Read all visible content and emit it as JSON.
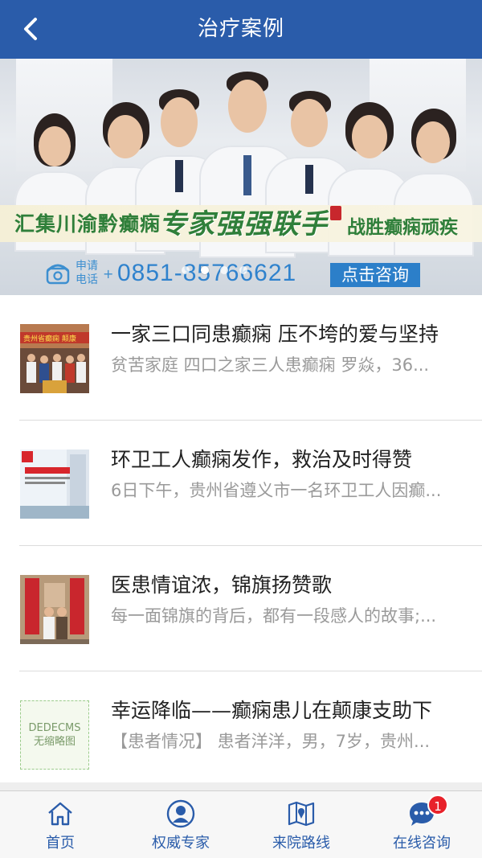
{
  "header": {
    "title": "治疗案例"
  },
  "banner": {
    "slogan_left": "汇集川渝黔癫痫",
    "slogan_mid": "专家强强联手",
    "slogan_right": "战胜癫痫顽疾",
    "phone_apply": "申请",
    "phone_call": "电话",
    "phone_plus": "+",
    "phone_number": "0851-85766621",
    "consult_label": "点击咨询",
    "active_slide": 1,
    "slide_count": 4
  },
  "articles": [
    {
      "title": "一家三口同患癫痫 压不垮的爱与坚持",
      "desc": "贫苦家庭 四口之家三人患癫痫 罗焱，36..."
    },
    {
      "title": "环卫工人癫痫发作，救治及时得赞",
      "desc": "6日下午，贵州省遵义市一名环卫工人因癫..."
    },
    {
      "title": "医患情谊浓，锦旗扬赞歌",
      "desc": "每一面锦旗的背后，都有一段感人的故事;..."
    },
    {
      "title": "幸运降临——癫痫患儿在颠康支助下",
      "desc": "【患者情况】 患者洋洋，男，7岁，贵州..."
    }
  ],
  "placeholder_thumb": {
    "line1": "DEDECMS",
    "line2": "无缩略图"
  },
  "tabbar": {
    "tabs": [
      {
        "label": "首页",
        "icon": "home-icon"
      },
      {
        "label": "权威专家",
        "icon": "expert-icon"
      },
      {
        "label": "来院路线",
        "icon": "map-icon"
      },
      {
        "label": "在线咨询",
        "icon": "chat-icon"
      }
    ],
    "consult_badge": "1"
  },
  "colors": {
    "header": "#2a5caa",
    "tab_text": "#2a5caa",
    "badge": "#e8212a",
    "slogan": "#2f7f3a"
  }
}
